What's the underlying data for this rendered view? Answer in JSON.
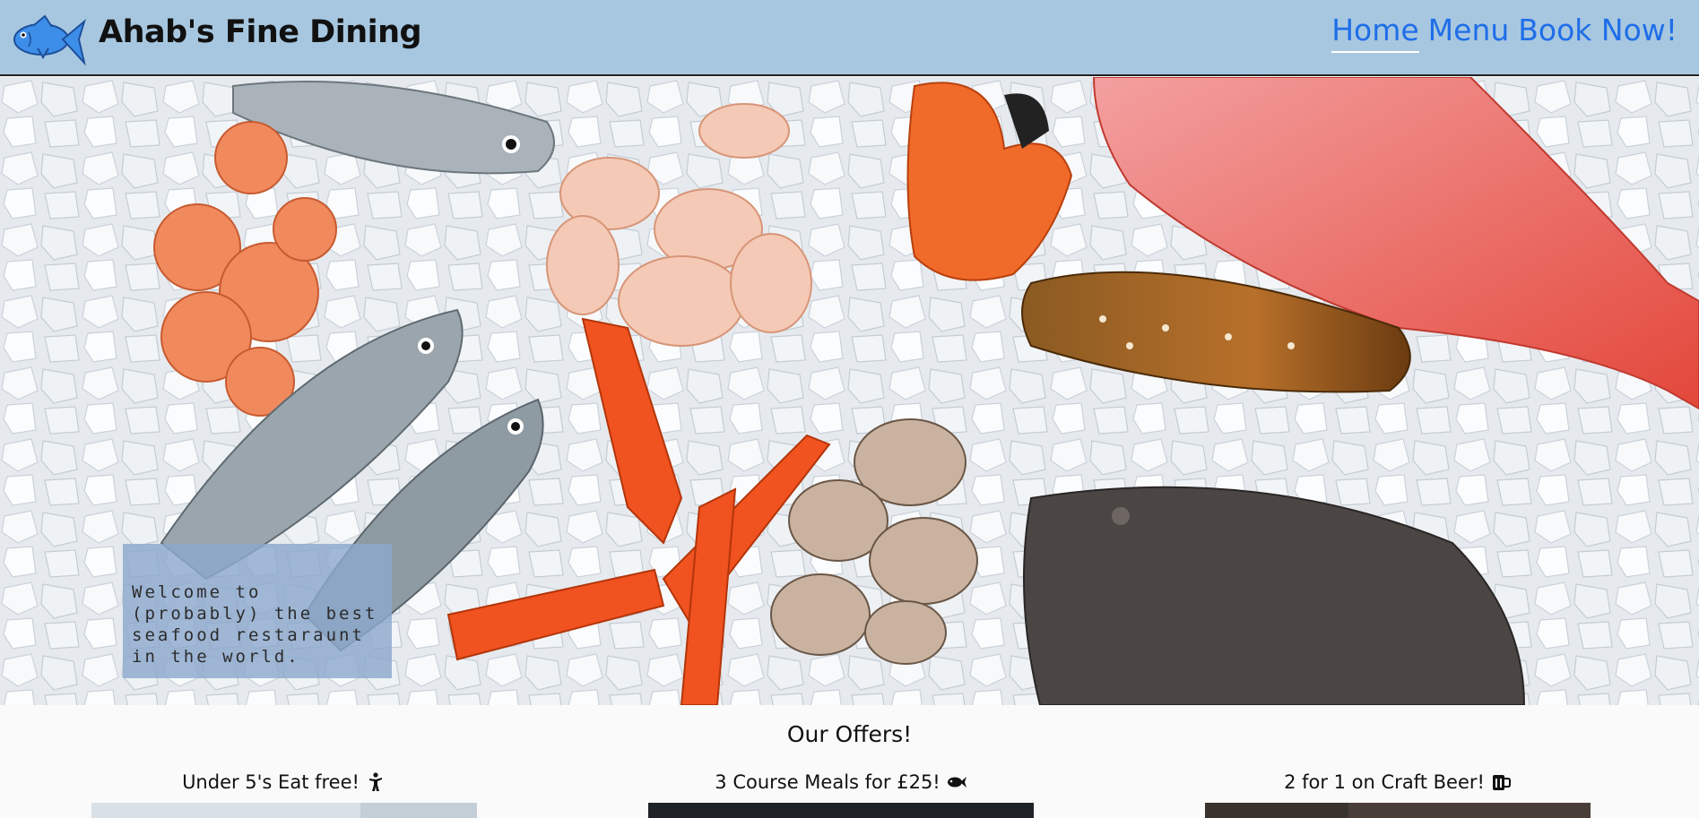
{
  "header": {
    "title": "Ahab's Fine Dining",
    "logo_icon": "fish-icon",
    "nav": [
      {
        "label": "Home",
        "active": true
      },
      {
        "label": "Menu",
        "active": false
      },
      {
        "label": "Book Now!",
        "active": false
      }
    ]
  },
  "hero": {
    "image": "seafood-on-ice-photo",
    "welcome": "Welcome to (probably) the best seafood restaraunt in the world."
  },
  "offers": {
    "title": "Our Offers!",
    "items": [
      {
        "label": "Under 5's Eat free!",
        "icon": "child-icon"
      },
      {
        "label": "3 Course Meals for £25!",
        "icon": "fish-icon"
      },
      {
        "label": "2 for 1 on Craft Beer!",
        "icon": "beer-mug-icon"
      }
    ]
  },
  "colors": {
    "header_bg": "#a7c7e0",
    "nav_link": "#1f6ee8",
    "welcome_bg": "#8ca8cd",
    "page_bg": "#fafafa"
  }
}
